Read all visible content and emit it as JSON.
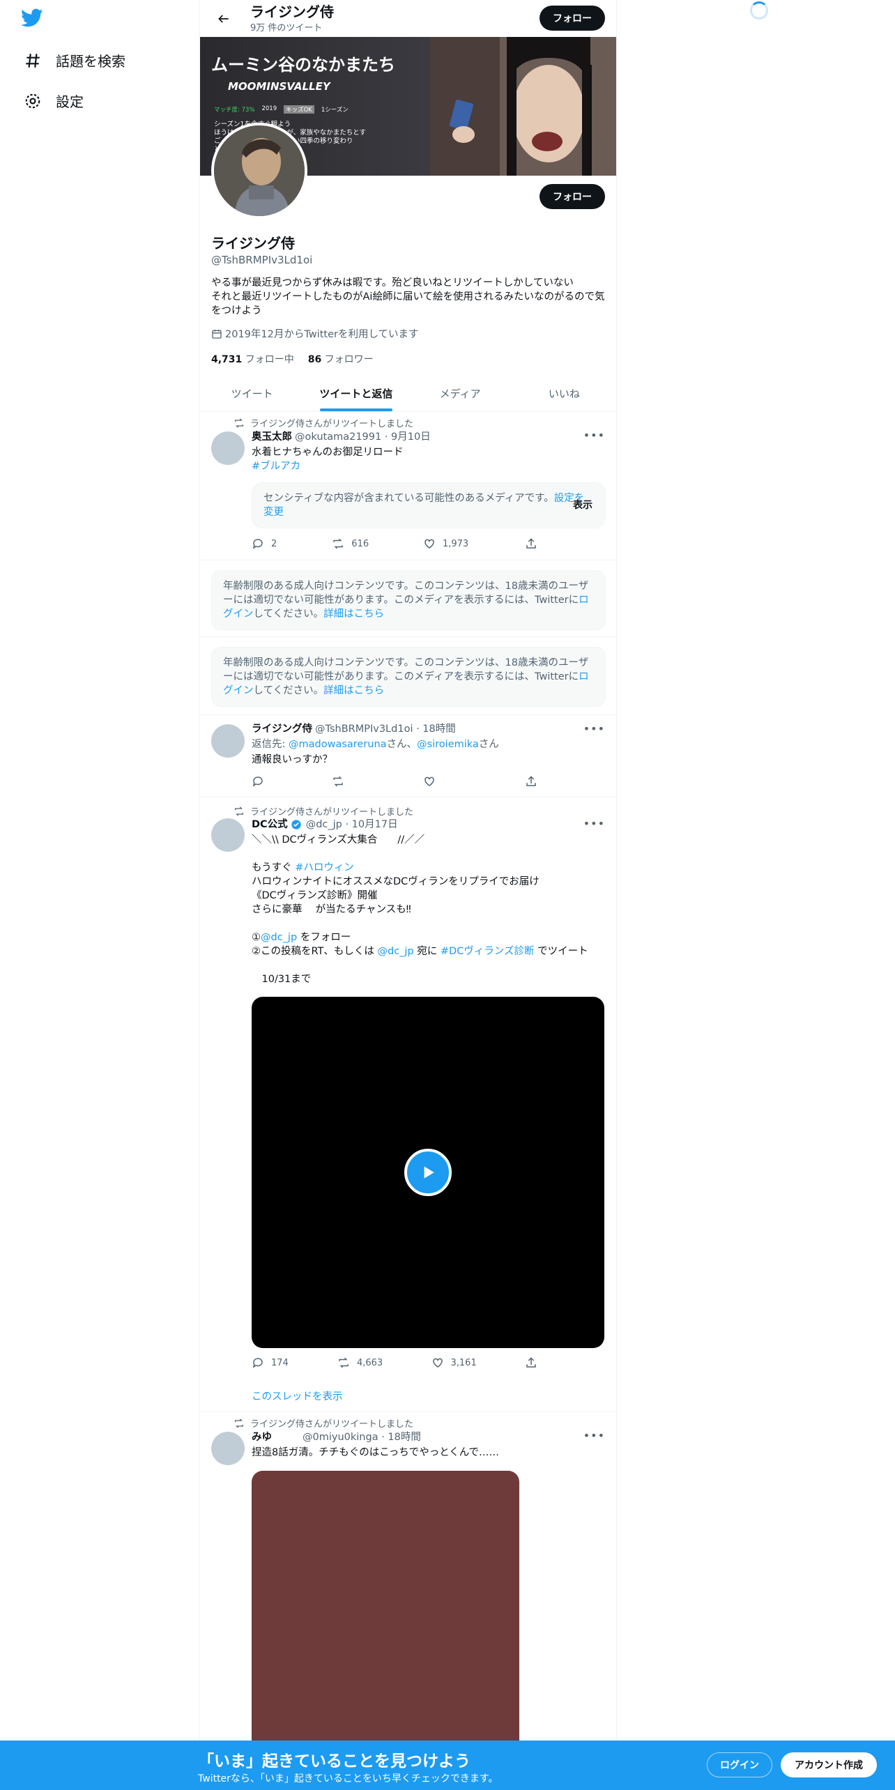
{
  "nav": {
    "items": [
      {
        "label": "話題を検索",
        "icon": "hashtag-icon"
      },
      {
        "label": "設定",
        "icon": "gear-icon"
      }
    ]
  },
  "header": {
    "title": "ライジング侍",
    "subtitle": "9万 件のツイート",
    "follow_label": "フォロー"
  },
  "profile": {
    "name": "ライジング侍",
    "handle": "@TshBRMPIv3Ld1oi",
    "bio": "やる事が最近見つからず休みは暇です。殆ど良いねとリツイートしかしていない\nそれと最近リツイートしたものがAi絵師に届いて絵を使用されるみたいなのがるので気をつけよう",
    "joined": "2019年12月からTwitterを利用しています",
    "following_count": "4,731",
    "following_label": "フォロー中",
    "followers_count": "86",
    "followers_label": "フォロワー",
    "follow_label": "フォロー"
  },
  "banner": {
    "title": "ムーミン谷のなかまたち",
    "subtitle": "MOOMINSVALLEY",
    "meta": [
      "マッチ度: 73%",
      "2019",
      "キッズOK",
      "1シーズン"
    ],
    "line1": "シーズン1を今すぐ観よう",
    "desc": "ほうけ　　　　　ロールが、家族やなかまたちとす\nご　　　　　　日を、美しい四季の移り変わり\nと　　　　　　　ンシリーズ。"
  },
  "tabs": [
    {
      "label": "ツイート",
      "active": false
    },
    {
      "label": "ツイートと返信",
      "active": true
    },
    {
      "label": "メディア",
      "active": false
    },
    {
      "label": "いいね",
      "active": false
    }
  ],
  "tweets": {
    "t1": {
      "retweet_label": "ライジング侍さんがリツイートしました",
      "name": "奥玉太郎",
      "meta": "@okutama21991 · 9月10日",
      "text": "水着ヒナちゃんのお御足リロード",
      "hashtag": "#ブルアカ",
      "sensitive_text": "センシティブな内容が含まれている可能性のあるメディアです。",
      "sensitive_link": "設定を変更",
      "show_label": "表示",
      "replies": "2",
      "retweets": "616",
      "likes": "1,973"
    },
    "age_notice": {
      "text_a": "年齢制限のある成人向けコンテンツです。このコンテンツは、18歳未満のユーザーには適切でない可能性があります。このメディアを表示するには、Twitterに",
      "login_link": "ログイン",
      "text_b": "してください。",
      "details_link": "詳細はこちら"
    },
    "t2": {
      "name": "ライジング侍",
      "meta": "@TshBRMPIv3Ld1oi · 18時間",
      "reply_prefix": "返信先: ",
      "reply_user1": "@madowasareruna",
      "reply_mid": "さん、",
      "reply_user2": "@siroiemika",
      "reply_suffix": "さん",
      "text": "通報良いっすか？"
    },
    "t3": {
      "retweet_label": "ライジング侍さんがリツイートしました",
      "name": "DC公式",
      "meta": "@dc_jp · 10月17日",
      "line1": "＼＼\\\\ DCヴィランズ大集合　　//／／",
      "line2_pre": "もうすぐ ",
      "line2_tag": "#ハロウィン",
      "line3": "ハロウィンナイトにオススメなDCヴィランをリプライでお届け",
      "line4": "《DCヴィランズ診断》開催",
      "line5": "さらに豪華　 が当たるチャンスも‼",
      "line6_pre": "①",
      "line6_user": "@dc_jp",
      "line6_post": " をフォロー",
      "line7_pre": "②この投稿をRT、もしくは ",
      "line7_user": "@dc_jp",
      "line7_mid": " 宛に ",
      "line7_tag": "#DCヴィランズ診断",
      "line7_post": " でツイート",
      "line8": "　10/31まで",
      "replies": "174",
      "retweets": "4,663",
      "likes": "3,161",
      "thread_link": "このスレッドを表示"
    },
    "t4": {
      "retweet_label": "ライジング侍さんがリツイートしました",
      "name": "みゆ",
      "meta": "@0miyu0kinga · 18時間",
      "text": "捏造8話ガ清。チチもぐのはこっちでやっとくんで……"
    }
  },
  "bottom_bar": {
    "title": "「いま」起きていることを見つけよう",
    "subtitle": "Twitterなら、「いま」起きていることをいち早くチェックできます。",
    "login_label": "ログイン",
    "signup_label": "アカウント作成"
  },
  "colors": {
    "accent": "#1d9bf0",
    "text": "#0f1419",
    "muted": "#536471"
  }
}
